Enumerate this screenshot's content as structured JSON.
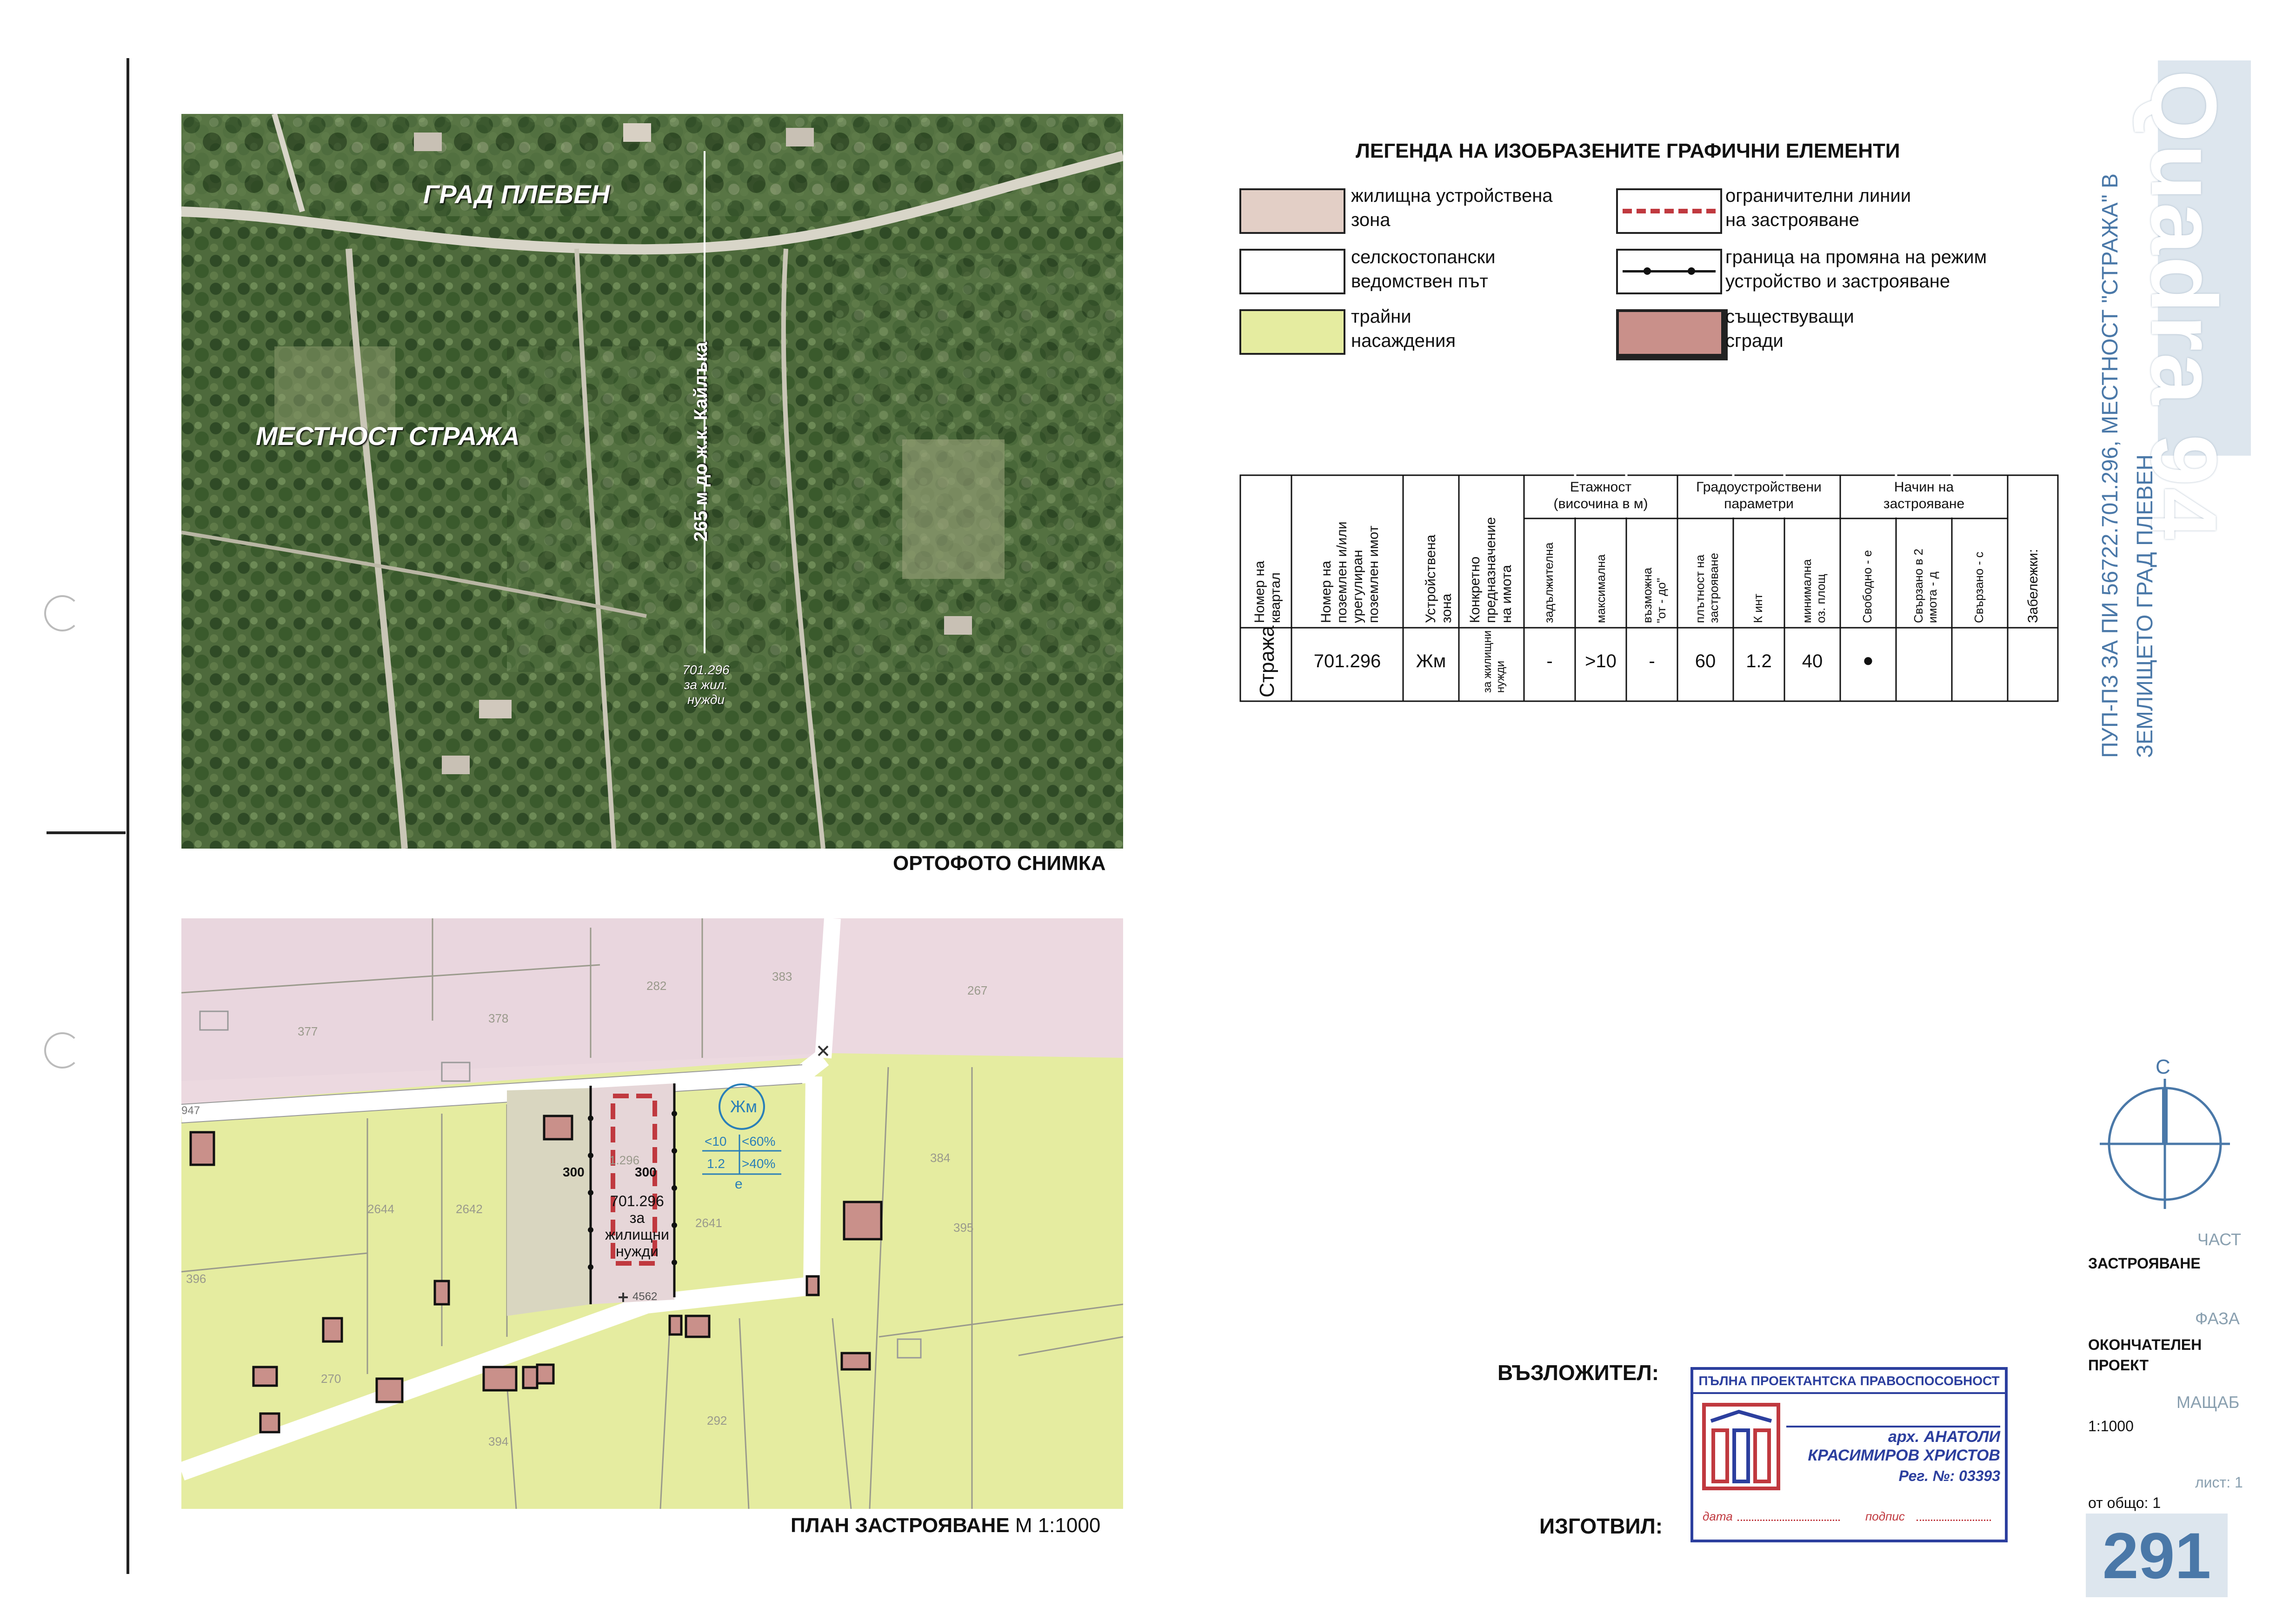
{
  "ortho": {
    "city_label": "ГРАД ПЛЕВЕН",
    "locality_label": "МЕСТНОСТ СТРАЖА",
    "distance_label": "265 м до ж.к. Кайлъка",
    "plot_label_1": "701.296",
    "plot_label_2": "за жил.",
    "plot_label_3": "нужди",
    "caption": "ОРТОФОТО СНИМКА"
  },
  "plan": {
    "caption_bold": "ПЛАН ЗАСТРОЯВАНЕ",
    "caption_scale": "М 1:1000",
    "zone": "Жм",
    "param_height": "<10",
    "param_density": "<60%",
    "param_kint": "1.2",
    "param_green": ">40%",
    "param_mode": "е",
    "dist_left": "300",
    "dist_right": "300",
    "plot_number": "701.296",
    "plot_use_1": "за",
    "plot_use_2": "жилищни",
    "plot_use_3": "нужди",
    "lot_labels": [
      "377",
      "378",
      "282",
      "383",
      "267",
      "2642",
      "2641",
      "2644",
      "1.296",
      "384",
      "396",
      "395",
      "270",
      "292",
      "394"
    ],
    "point_labels": [
      "947",
      "4562"
    ]
  },
  "legend": {
    "title": "ЛЕГЕНДА НА ИЗОБРАЗЕНИТЕ ГРАФИЧНИ ЕЛЕМЕНТИ",
    "items": [
      {
        "label": "жилищна устройствена\nзона",
        "color": "#e3cfc6"
      },
      {
        "label": "селскостопански\nведомствен път",
        "color": "#ffffff"
      },
      {
        "label": "трайни\nнасаждения",
        "color": "#e5eca0"
      },
      {
        "label": "ограничителни линии\nна застрояване",
        "color": "#c0393f"
      },
      {
        "label": "граница на промяна на режим\nустройство и застрояване",
        "color": "#111111"
      },
      {
        "label": "съществуващи\nсгради",
        "color": "#c9908a"
      }
    ]
  },
  "table": {
    "headers": {
      "quarter": "Номер на\nквартал",
      "plot": "Номер на\nпоземлен и/или\nурегулиран\nпоземлен имот",
      "zone": "Устройствена\nзона",
      "purpose": "Конкретно\nпредназначение\nна имота",
      "floors_group": "Етажност\n(височина в м)",
      "floors_req": "задължителна",
      "floors_max": "максимална",
      "floors_range": "възможна\n\"от - до\"",
      "params_group": "Градоустройствени\nпараметри",
      "density": "плътност на\nзастрояване",
      "kint": "К инт",
      "green": "минимална\nоз. площ",
      "mode_group": "Начин на\nзастрояване",
      "mode_free": "Свободно - е",
      "mode_pair": "Свързано в 2\nимота - д",
      "mode_linked": "Свързано - с",
      "notes": "Забележки:"
    },
    "row": {
      "quarter": "Стража",
      "plot": "701.296",
      "zone": "Жм",
      "purpose": "за жилищни\nнужди",
      "floors_req": "-",
      "floors_max": ">10",
      "floors_range": "-",
      "density": "60",
      "kint": "1.2",
      "green": "40",
      "mode_free": "●"
    }
  },
  "titleblock": {
    "project_line1": "ПУП-ПЗ ЗА ПИ 56722.701.296, МЕСТНОСТ \"СТРАЖА\" В",
    "project_line2": "ЗЕМЛИЩЕТО ГРАД ПЛЕВЕН",
    "logo_text": "Quadra 94",
    "north": "С",
    "part_label": "ЧАСТ",
    "part_value": "ЗАСТРОЯВАНЕ",
    "phase_label": "ФАЗА",
    "phase_value": "ОКОНЧАТЕЛЕН\nПРОЕКТ",
    "scale_label": "МАЩАБ",
    "scale_value": "1:1000",
    "sheet_label": "лист: 1",
    "sheet_total": "от общо: 1",
    "sheet_number": "291"
  },
  "signatures": {
    "client": "ВЪЗЛОЖИТЕЛ:",
    "author": "ИЗГОТВИЛ:"
  },
  "stamp": {
    "header": "ПЪЛНА ПРОЕКТАНТСКА ПРАВОСПОСОБНОСТ",
    "name_line1": "арх. АНАТОЛИ",
    "name_line2": "КРАСИМИРОВ ХРИСТОВ",
    "reg": "Рег. №: 03393",
    "date": "дата",
    "signature": "подпис"
  },
  "colors": {
    "residential_zone": "#e3cfc6",
    "orchards": "#e5eca0",
    "building": "#c9908a",
    "restriction_line": "#c0393f",
    "zone_blue": "#2a7fb8",
    "stamp_blue": "#2c3f9e",
    "stamp_red": "#c0393f",
    "titleblock_blue": "#4a78a8"
  }
}
